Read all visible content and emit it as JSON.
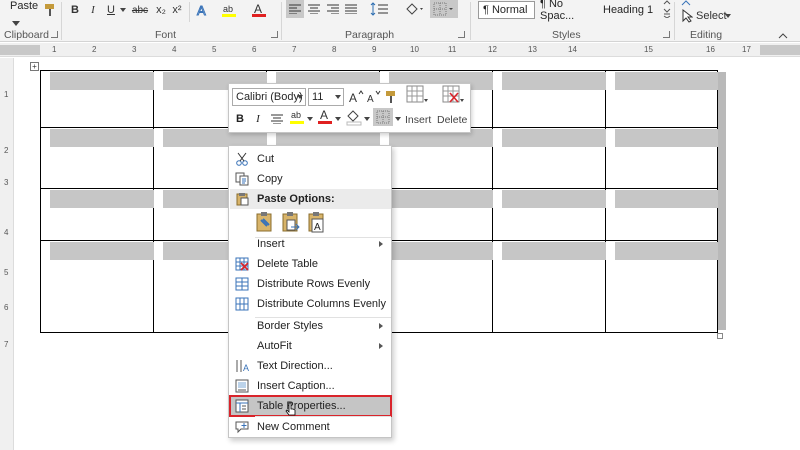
{
  "ribbon": {
    "clipboard": {
      "paste_label": "Paste",
      "group_label": "Clipboard"
    },
    "font": {
      "group_label": "Font",
      "bold": "B",
      "italic": "I",
      "underline": "U",
      "strike": "abc",
      "subscript": "x₂",
      "superscript": "x²"
    },
    "paragraph": {
      "group_label": "Paragraph"
    },
    "styles": {
      "group_label": "Styles",
      "items": [
        "¶ Normal",
        "¶ No Spac...",
        "Heading 1"
      ]
    },
    "editing": {
      "group_label": "Editing",
      "select_label": "Select"
    }
  },
  "ruler": {
    "h_ticks": [
      "1",
      "2",
      "3",
      "4",
      "5",
      "6",
      "7",
      "8",
      "9",
      "10",
      "11",
      "12",
      "13",
      "14",
      "15",
      "16",
      "17"
    ],
    "v_ticks": [
      "1",
      "2",
      "3",
      "4",
      "5",
      "6",
      "7"
    ]
  },
  "table": {
    "rows": 4,
    "columns": 6
  },
  "mini_toolbar": {
    "font_name": "Calibri (Body)",
    "font_size": "11",
    "bold": "B",
    "italic": "I",
    "font_color_glyph": "A",
    "insert_label": "Insert",
    "delete_label": "Delete"
  },
  "context_menu": {
    "items": [
      {
        "label": "Cut",
        "icon": "cut-icon"
      },
      {
        "label": "Copy",
        "icon": "copy-icon"
      },
      {
        "label": "Paste Options:",
        "icon": "paste-icon"
      },
      {
        "label": "Insert",
        "icon": ""
      },
      {
        "label": "Delete Table",
        "icon": "delete-table-icon"
      },
      {
        "label": "Distribute Rows Evenly",
        "icon": "distribute-rows-icon"
      },
      {
        "label": "Distribute Columns Evenly",
        "icon": "distribute-columns-icon"
      },
      {
        "label": "Border Styles",
        "icon": ""
      },
      {
        "label": "AutoFit",
        "icon": ""
      },
      {
        "label": "Text Direction...",
        "icon": "text-direction-icon"
      },
      {
        "label": "Insert Caption...",
        "icon": "insert-caption-icon"
      },
      {
        "label": "Table Properties...",
        "icon": "table-properties-icon"
      },
      {
        "label": "New Comment",
        "icon": "new-comment-icon"
      }
    ],
    "highlighted_item": "Table Properties...",
    "highlight_color": "#d9242b"
  }
}
